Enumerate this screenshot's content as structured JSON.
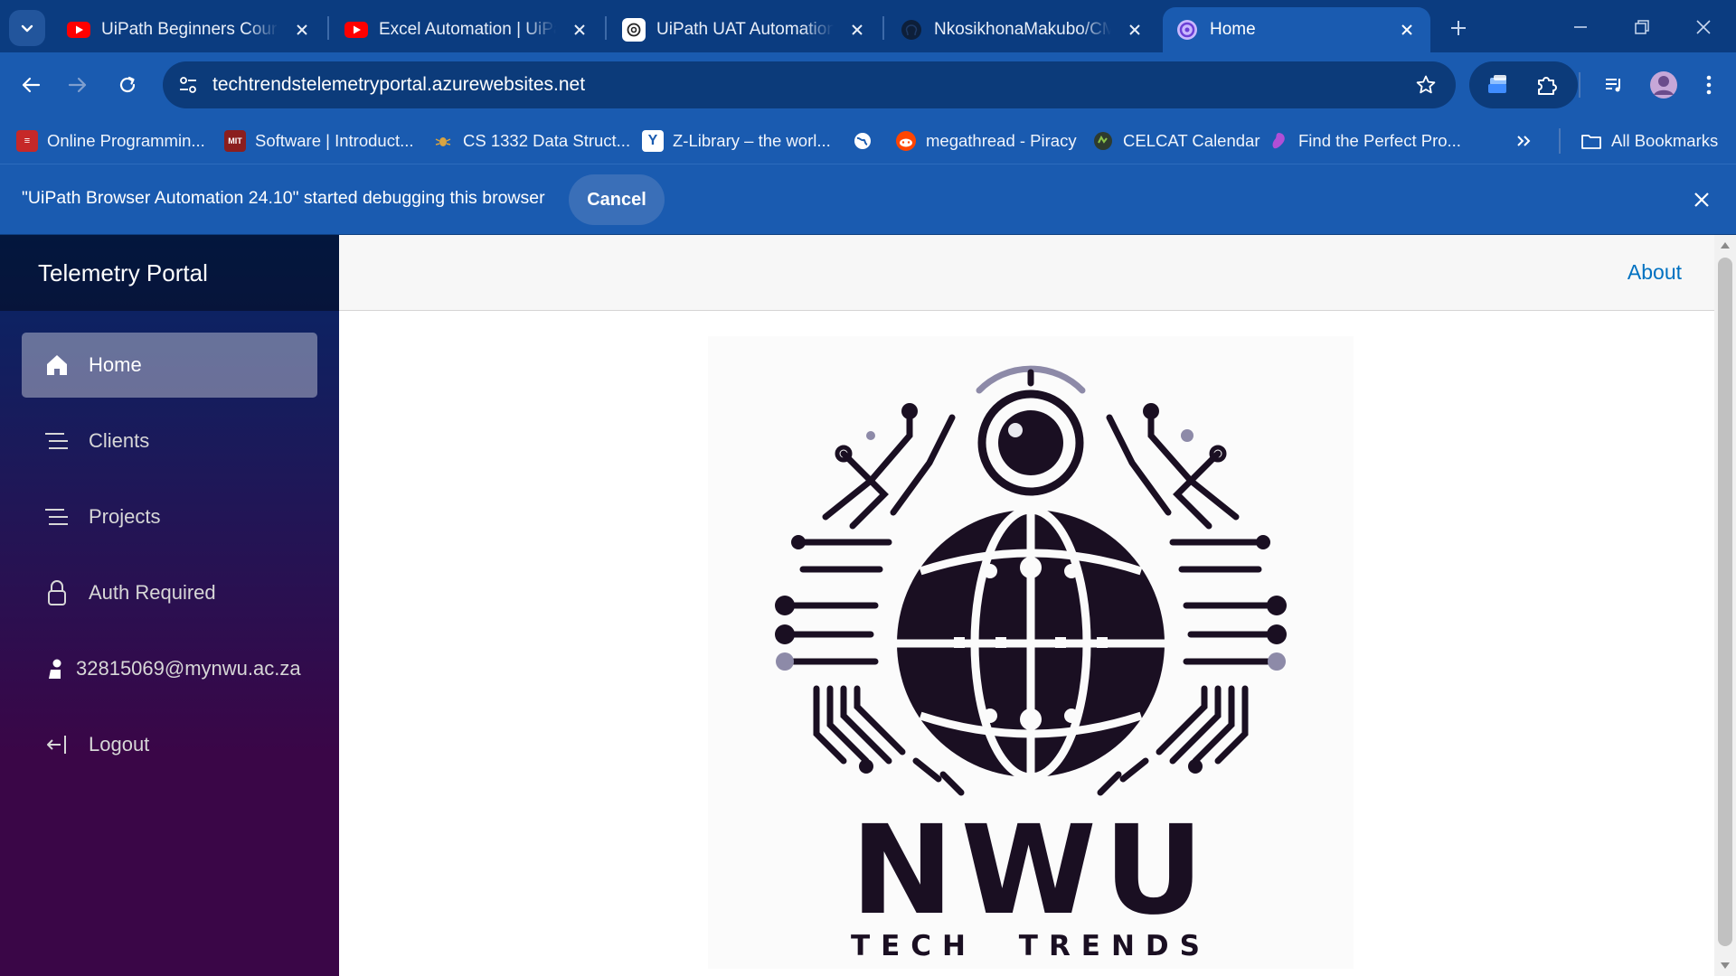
{
  "browser": {
    "tabs": [
      {
        "title": "UiPath Beginners Course",
        "icon": "youtube-icon",
        "active": false
      },
      {
        "title": "Excel Automation | UiPath",
        "icon": "youtube-icon",
        "active": false
      },
      {
        "title": "UiPath UAT Automation S",
        "icon": "chatgpt-icon",
        "active": false
      },
      {
        "title": "NkosikhonaMakubo/CMP",
        "icon": "github-icon",
        "active": false
      },
      {
        "title": "Home",
        "icon": "blazor-icon",
        "active": true
      }
    ],
    "address_bar": {
      "url": "techtrendstelemetryportal.azurewebsites.net"
    },
    "bookmarks": [
      {
        "label": "Online Programmin...",
        "icon": "bookmark-site-icon"
      },
      {
        "label": "Software | Introduct...",
        "icon": "mit-ocw-icon"
      },
      {
        "label": "CS 1332 Data Struct...",
        "icon": "bug-icon"
      },
      {
        "label": "Z-Library – the worl...",
        "icon": "zlibrary-icon"
      },
      {
        "label": "",
        "icon": "globe-icon"
      },
      {
        "label": "megathread - Piracy",
        "icon": "reddit-icon"
      },
      {
        "label": "CELCAT Calendar",
        "icon": "celcat-icon"
      },
      {
        "label": "Find the Perfect Pro...",
        "icon": "purple-site-icon"
      }
    ],
    "all_bookmarks_label": "All Bookmarks",
    "debug_banner": {
      "message": "\"UiPath Browser Automation 24.10\" started debugging this browser",
      "cancel_label": "Cancel"
    }
  },
  "app": {
    "brand": "Telemetry Portal",
    "nav": [
      {
        "label": "Home",
        "icon": "home-icon",
        "active": true
      },
      {
        "label": "Clients",
        "icon": "list-icon",
        "active": false
      },
      {
        "label": "Projects",
        "icon": "list-icon",
        "active": false
      },
      {
        "label": "Auth Required",
        "icon": "lock-icon",
        "active": false
      },
      {
        "label": "32815069@mynwu.ac.za",
        "icon": "person-icon",
        "active": false
      },
      {
        "label": "Logout",
        "icon": "logout-icon",
        "active": false
      }
    ],
    "top_link": "About",
    "logo": {
      "word": "NWU",
      "subtitle": "TECH TRENDS"
    }
  },
  "colors": {
    "chrome_tabbar": "#0b3c80",
    "chrome_toolbar": "#1a5bb0",
    "sidebar_top": "#052767",
    "sidebar_bottom": "#3a0647",
    "link": "#0071c1"
  }
}
